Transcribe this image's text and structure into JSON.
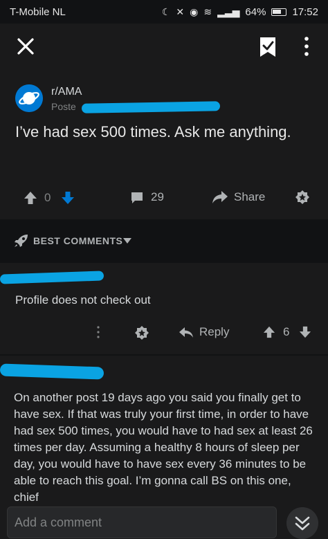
{
  "status_bar": {
    "carrier": "T-Mobile NL",
    "battery": "64%",
    "time": "17:52"
  },
  "post": {
    "subreddit": "r/AMA",
    "posted_by": "Poste",
    "title": "I’ve had sex 500 times. Ask me anything.",
    "score": "0",
    "comment_count": "29",
    "share_label": "Share"
  },
  "sort": {
    "label": "BEST COMMENTS"
  },
  "comments": [
    {
      "text": "Profile does not check out",
      "reply_label": "Reply",
      "score": "6"
    },
    {
      "text": "On another post 19 days ago you said you finally get to have sex. If that was truly your first time, in order to have had sex 500 times, you would have to had sex at least 26 times per day. Assuming a healthy 8 hours of sleep per day, you would have to have sex every 36 minutes to be able to reach this goal. I’m gonna call BS on this one, chief"
    }
  ],
  "composer": {
    "placeholder": "Add a comment"
  },
  "colors": {
    "background": "#111214",
    "card": "#1a1a1b",
    "upvote_accent": "#0079d3",
    "redaction": "#0aa3e3"
  },
  "icons": [
    "close-icon",
    "save-icon",
    "more-vertical-icon",
    "upvote-icon",
    "downvote-icon",
    "comment-icon",
    "share-icon",
    "award-icon",
    "rocket-icon",
    "chevron-down-icon",
    "reply-icon"
  ]
}
